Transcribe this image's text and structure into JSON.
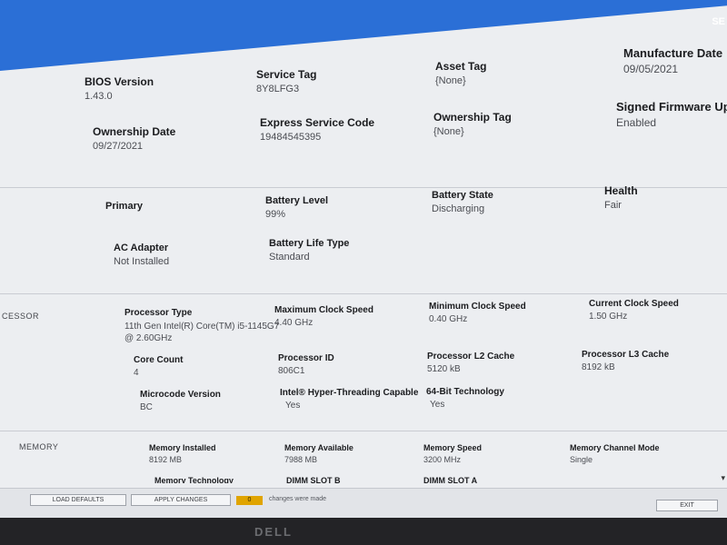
{
  "header": {
    "right_label": "SE"
  },
  "system": {
    "bios_version": {
      "label": "BIOS Version",
      "value": "1.43.0"
    },
    "service_tag": {
      "label": "Service Tag",
      "value": "8Y8LFG3"
    },
    "asset_tag": {
      "label": "Asset Tag",
      "value": "{None}"
    },
    "manufacture_date": {
      "label": "Manufacture Date",
      "value": "09/05/2021"
    },
    "ownership_date": {
      "label": "Ownership Date",
      "value": "09/27/2021"
    },
    "express_service_code": {
      "label": "Express Service Code",
      "value": "19484545395"
    },
    "ownership_tag": {
      "label": "Ownership Tag",
      "value": "{None}"
    },
    "signed_firmware": {
      "label": "Signed Firmware Upd",
      "value": "Enabled"
    }
  },
  "battery": {
    "primary": {
      "label": "Primary"
    },
    "battery_level": {
      "label": "Battery Level",
      "value": "99%"
    },
    "battery_state": {
      "label": "Battery State",
      "value": "Discharging"
    },
    "health": {
      "label": "Health",
      "value": "Fair"
    },
    "ac_adapter": {
      "label": "AC Adapter",
      "value": "Not Installed"
    },
    "battery_life_type": {
      "label": "Battery Life Type",
      "value": "Standard"
    }
  },
  "processor": {
    "section_label": "CESSOR",
    "processor_type": {
      "label": "Processor Type",
      "value": "11th Gen Intel(R) Core(TM) i5-1145G7 @ 2.60GHz"
    },
    "max_clock": {
      "label": "Maximum Clock Speed",
      "value": "4.40 GHz"
    },
    "min_clock": {
      "label": "Minimum Clock Speed",
      "value": "0.40 GHz"
    },
    "current_clock": {
      "label": "Current Clock Speed",
      "value": "1.50 GHz"
    },
    "core_count": {
      "label": "Core Count",
      "value": "4"
    },
    "processor_id": {
      "label": "Processor ID",
      "value": "806C1"
    },
    "l2_cache": {
      "label": "Processor L2 Cache",
      "value": "5120 kB"
    },
    "l3_cache": {
      "label": "Processor L3 Cache",
      "value": "8192 kB"
    },
    "microcode": {
      "label": "Microcode Version",
      "value": "BC"
    },
    "hyperthreading": {
      "label": "Intel® Hyper-Threading Capable",
      "value": "Yes"
    },
    "bit64": {
      "label": "64-Bit Technology",
      "value": "Yes"
    }
  },
  "memory": {
    "section_label": "MEMORY",
    "installed": {
      "label": "Memory Installed",
      "value": "8192 MB"
    },
    "available": {
      "label": "Memory Available",
      "value": "7988 MB"
    },
    "speed": {
      "label": "Memory Speed",
      "value": "3200 MHz"
    },
    "channel_mode": {
      "label": "Memory Channel Mode",
      "value": "Single"
    },
    "technology": {
      "label": "Memory Technology"
    },
    "dimm_b": {
      "label": "DIMM SLOT B"
    },
    "dimm_a": {
      "label": "DIMM SLOT A"
    }
  },
  "footer": {
    "load_defaults": "LOAD DEFAULTS",
    "apply_changes": "APPLY CHANGES",
    "changes_count": "0",
    "changes_text": "changes were made",
    "exit": "EXIT"
  },
  "bezel": {
    "logo": "DELL"
  },
  "colors": {
    "header_blue": "#2b6fd6",
    "changes_badge": "#e0a400"
  }
}
